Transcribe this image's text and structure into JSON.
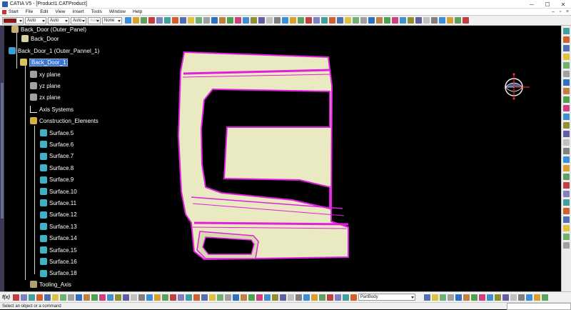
{
  "window": {
    "title": "CATIA V5 - [Product1.CATProduct]",
    "min": "─",
    "max": "☐",
    "close": "✕"
  },
  "menubar": {
    "items": [
      "Start",
      "File",
      "Edit",
      "View",
      "Insert",
      "Tools",
      "Window",
      "Help"
    ],
    "mdi_min": "–",
    "mdi_max": "▫",
    "mdi_close": "×"
  },
  "toolbar": {
    "fill_color": "#8b1a1a",
    "linetype": "Auto",
    "thickness": "Auto",
    "pointstyle": "Auto",
    "layer_auto": "Auto",
    "layer": "None",
    "icon_colors": [
      "#3a8fd8",
      "#d8a030",
      "#60a060",
      "#c04040",
      "#8080c0",
      "#40a0a0",
      "#d06030",
      "#5070b0",
      "#e0c040",
      "#70b070",
      "#a0a0a0",
      "#3070c0",
      "#c08040",
      "#50a050",
      "#d04080",
      "#4090d0",
      "#909030",
      "#6060a0",
      "#c0c0c0",
      "#808080"
    ]
  },
  "tree": {
    "items": [
      {
        "label": "Back_Door (Outer_Panel)",
        "icon_color": "#c8b070"
      },
      {
        "label": "Back_Door",
        "icon_color": "#d8d0a0"
      },
      {
        "label": "Back_Door_1 (Outer_Pannel_1)",
        "icon_color": "#3aa0d8"
      },
      {
        "label": "Back_Door_1",
        "icon_color": "#d8c060"
      },
      {
        "label": "xy plane",
        "icon_color": "#a0a0a0"
      },
      {
        "label": "yz plane",
        "icon_color": "#a0a0a0"
      },
      {
        "label": "zx plane",
        "icon_color": "#a0a0a0"
      },
      {
        "label": "Axis Systems",
        "icon_color": "#000000"
      },
      {
        "label": "Construction_Elements",
        "icon_color": "#d8b040"
      },
      {
        "label": "Surface.5",
        "icon_color": "#40b0c8"
      },
      {
        "label": "Surface.6",
        "icon_color": "#40b0c8"
      },
      {
        "label": "Surface.7",
        "icon_color": "#40b0c8"
      },
      {
        "label": "Surface.8",
        "icon_color": "#40b0c8"
      },
      {
        "label": "Surface.9",
        "icon_color": "#40b0c8"
      },
      {
        "label": "Surface.10",
        "icon_color": "#40b0c8"
      },
      {
        "label": "Surface.11",
        "icon_color": "#40b0c8"
      },
      {
        "label": "Surface.12",
        "icon_color": "#40b0c8"
      },
      {
        "label": "Surface.13",
        "icon_color": "#40b0c8"
      },
      {
        "label": "Surface.14",
        "icon_color": "#40b0c8"
      },
      {
        "label": "Surface.15",
        "icon_color": "#40b0c8"
      },
      {
        "label": "Surface.16",
        "icon_color": "#40b0c8"
      },
      {
        "label": "Surface.18",
        "icon_color": "#40b0c8"
      },
      {
        "label": "Tooling_Axis",
        "icon_color": "#b0a070"
      }
    ]
  },
  "model": {
    "surface_color": "#eaeac2",
    "edge_color": "#e020e0"
  },
  "bottom_toolbar": {
    "fx": "f(x)",
    "body_combo": "PartBody"
  },
  "status": {
    "prompt": "Select an object or a command"
  }
}
